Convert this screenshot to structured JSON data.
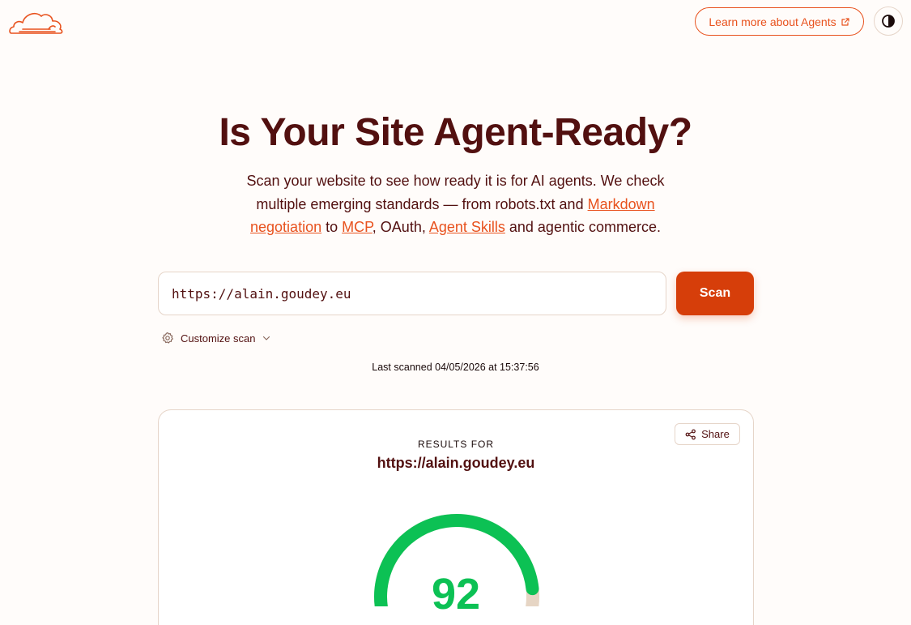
{
  "header": {
    "learn_more_label": "Learn more about Agents"
  },
  "hero": {
    "title": "Is Your Site Agent-Ready?",
    "subtitle_parts": {
      "p1": "Scan your website to see how ready it is for AI agents. We check multiple emerging standards — from robots.txt and ",
      "link1": "Markdown negotiation",
      "p2": " to ",
      "link2": "MCP",
      "p3": ", OAuth, ",
      "link3": "Agent Skills",
      "p4": " and agentic commerce."
    }
  },
  "scan": {
    "url_value": "https://alain.goudey.eu",
    "button_label": "Scan",
    "customize_label": "Customize scan",
    "last_scanned": "Last scanned 04/05/2026 at 15:37:56"
  },
  "results": {
    "label": "RESULTS FOR",
    "url": "https://alain.goudey.eu",
    "share_label": "Share",
    "score": "92",
    "score_value": 92,
    "score_max": 100
  },
  "colors": {
    "accent": "#e8521e",
    "primary_button": "#d63e0a",
    "text_dark": "#521010",
    "score_green": "#0cc154",
    "gauge_track": "#e6d5c4",
    "background": "#fffcfa"
  }
}
